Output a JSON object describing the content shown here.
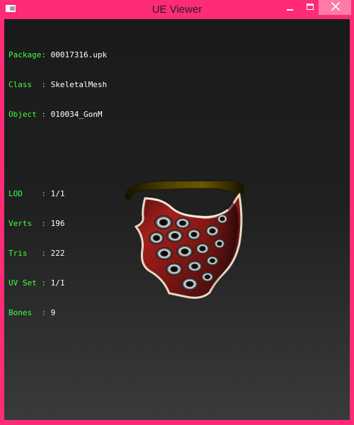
{
  "window": {
    "title": "UE Viewer",
    "accent": "#ff2a78"
  },
  "controls": {
    "minimize_icon": "minimize-icon",
    "maximize_icon": "maximize-icon",
    "close_icon": "close-icon"
  },
  "info": {
    "package_label": "Package:",
    "package_value": "00017316.upk",
    "class_label": "Class  :",
    "class_value": "SkeletalMesh",
    "object_label": "Object :",
    "object_value": "010034_GonM",
    "lod_label": "LOD    :",
    "lod_value": "1/1",
    "verts_label": "Verts  :",
    "verts_value": "196",
    "tris_label": "Tris   :",
    "tris_value": "222",
    "uvset_label": "UV Set :",
    "uvset_value": "1/1",
    "bones_label": "Bones  :",
    "bones_value": "9"
  },
  "viewport": {
    "label_color": "#40ff40",
    "value_color": "#ffffff",
    "mesh_name": "skeletal-mesh-preview"
  }
}
